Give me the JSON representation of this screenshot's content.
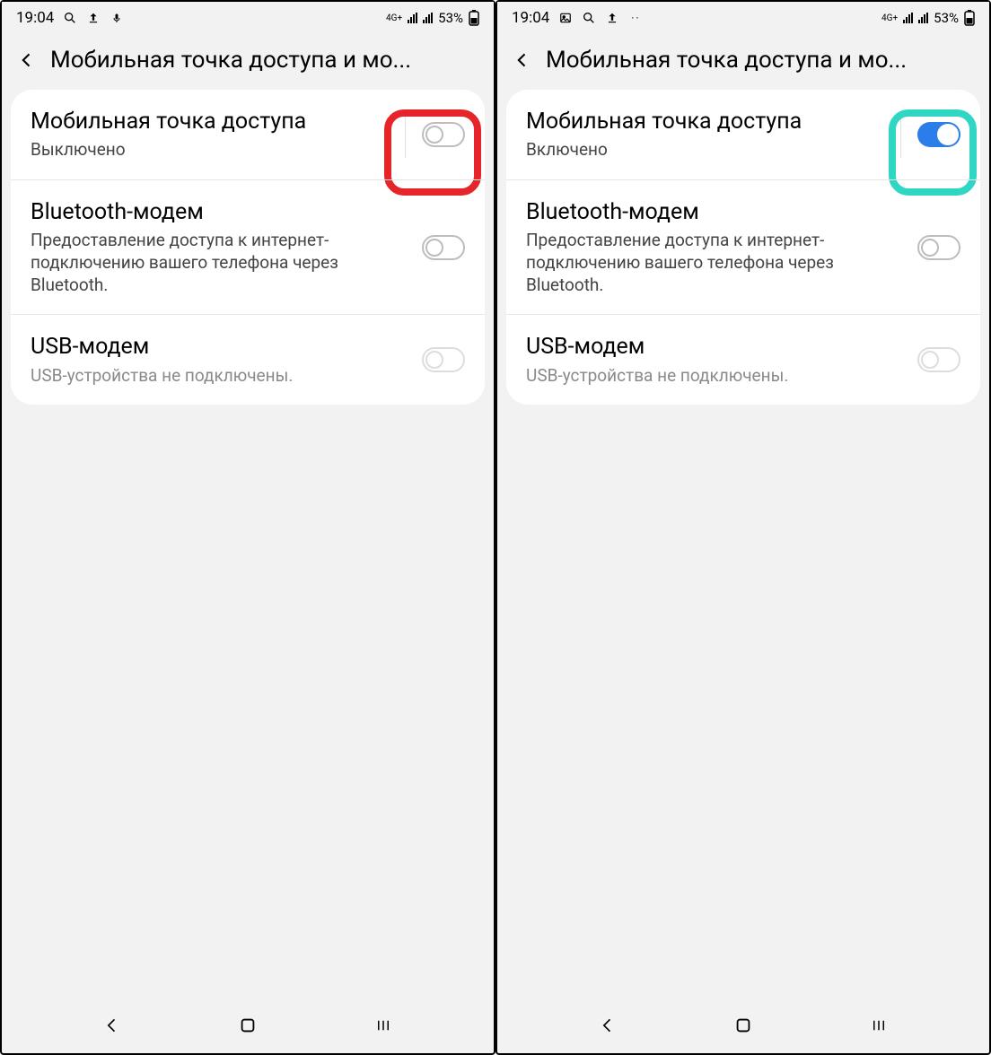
{
  "left": {
    "status": {
      "time": "19:04",
      "net": "4G+",
      "pct": "53%"
    },
    "header": {
      "title": "Мобильная точка доступа и мо..."
    },
    "rows": {
      "hotspot": {
        "title": "Мобильная точка доступа",
        "sub": "Выключено"
      },
      "bluetooth": {
        "title": "Bluetooth-модем",
        "sub": "Предоставление доступа к интернет-подключению вашего телефона через Bluetooth."
      },
      "usb": {
        "title": "USB-модем",
        "sub": "USB-устройства не подключены."
      }
    },
    "highlight_color": "red"
  },
  "right": {
    "status": {
      "time": "19:04",
      "net": "4G+",
      "pct": "53%"
    },
    "header": {
      "title": "Мобильная точка доступа и мо..."
    },
    "rows": {
      "hotspot": {
        "title": "Мобильная точка доступа",
        "sub": "Включено"
      },
      "bluetooth": {
        "title": "Bluetooth-модем",
        "sub": "Предоставление доступа к интернет-подключению вашего телефона через Bluetooth."
      },
      "usb": {
        "title": "USB-модем",
        "sub": "USB-устройства не подключены."
      }
    },
    "highlight_color": "teal"
  }
}
